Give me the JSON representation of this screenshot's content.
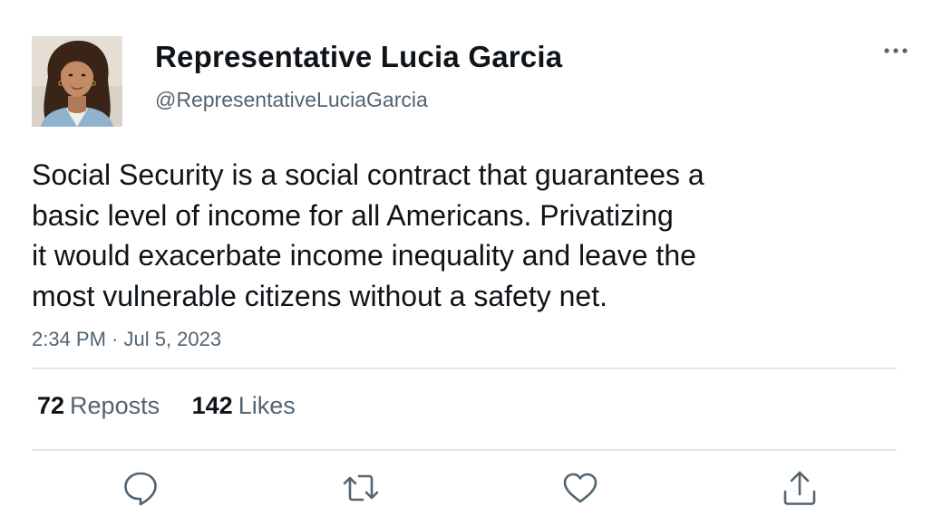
{
  "author": {
    "display_name": "Representative Lucia Garcia",
    "handle": "@RepresentativeLuciaGarcia",
    "avatar_icon": "profile-photo"
  },
  "tweet": {
    "text": "Social Security is a social contract that guarantees a\nbasic level of income for all Americans. Privatizing\nit would exacerbate income inequality and leave the\nmost vulnerable citizens without a safety net.",
    "timestamp": "2:34 PM · Jul 5, 2023"
  },
  "stats": {
    "reposts_count": "72",
    "reposts_label": "Reposts",
    "likes_count": "142",
    "likes_label": "Likes"
  },
  "actions": [
    {
      "name": "reply",
      "icon": "reply-icon"
    },
    {
      "name": "repost",
      "icon": "repost-icon"
    },
    {
      "name": "like",
      "icon": "heart-icon"
    },
    {
      "name": "share",
      "icon": "share-icon"
    }
  ],
  "colors": {
    "primary_text": "#0f1419",
    "secondary_text": "#536471",
    "icon": "#536471",
    "divider": "#e1e5e8"
  }
}
